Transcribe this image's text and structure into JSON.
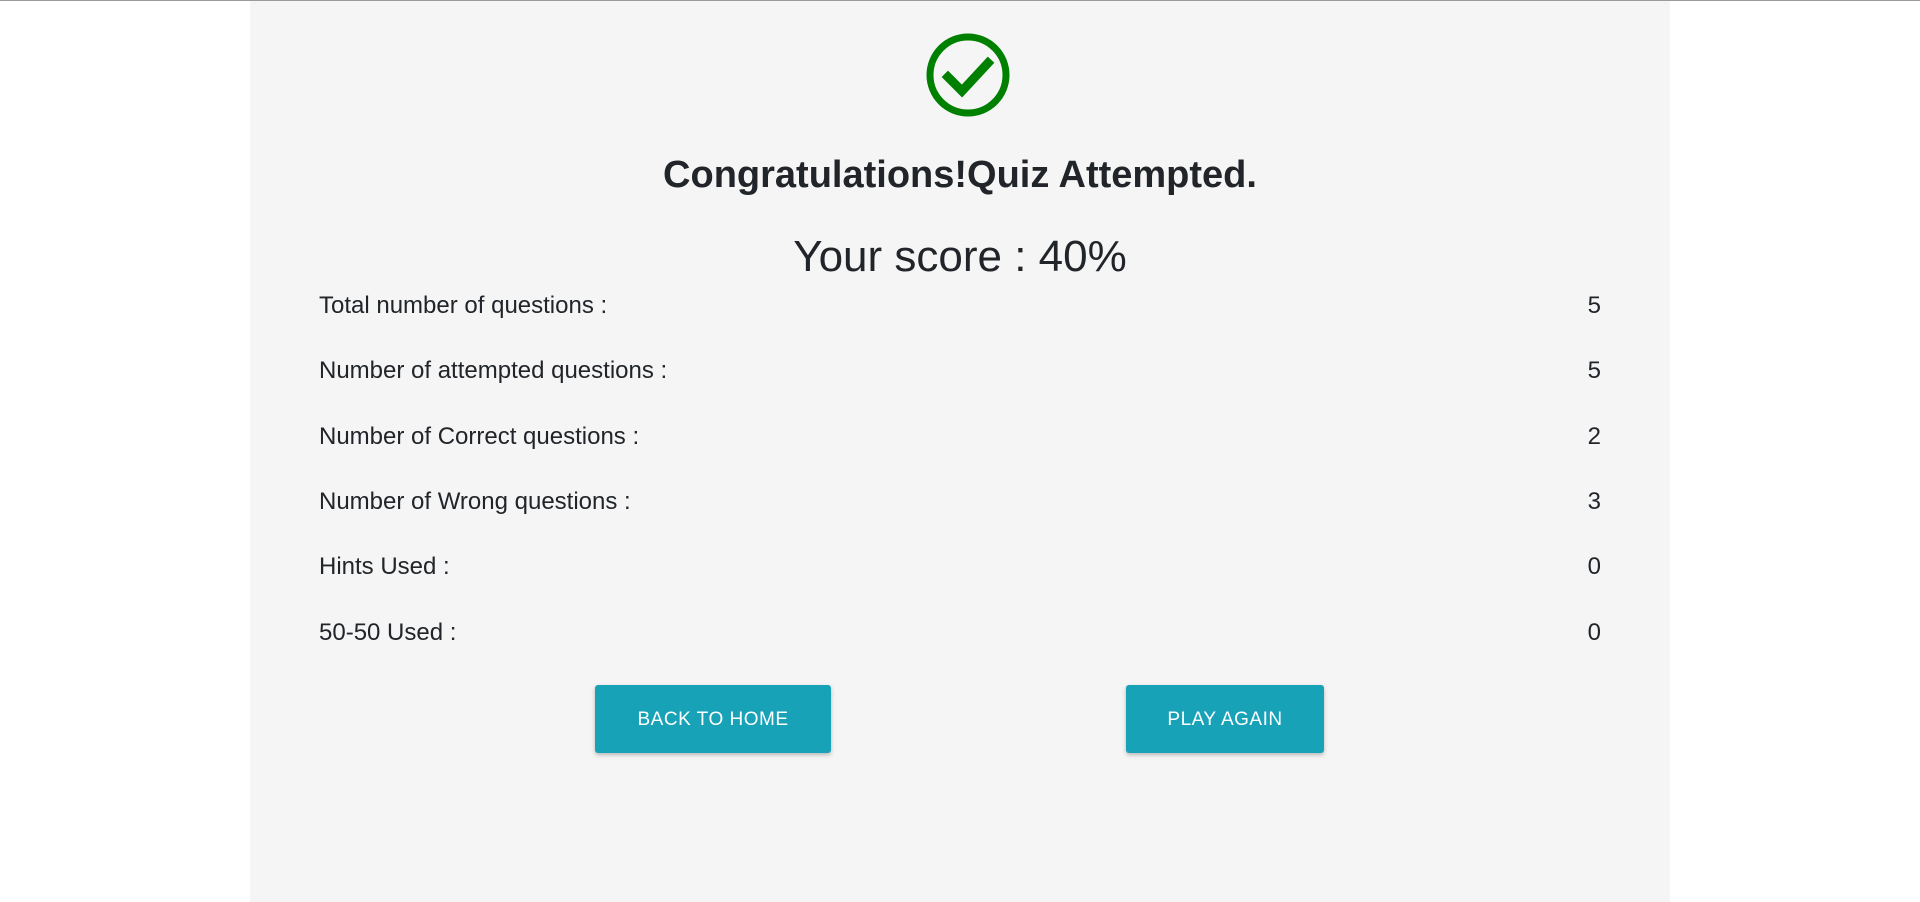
{
  "status": {
    "icon": "check-circle-icon",
    "icon_color": "#008000"
  },
  "title": "Congratulations!Quiz Attempted.",
  "score_text": "Your score : 40%",
  "stats": [
    {
      "label": "Total number of questions :",
      "value": "5"
    },
    {
      "label": "Number of attempted questions :",
      "value": "5"
    },
    {
      "label": "Number of Correct questions :",
      "value": "2"
    },
    {
      "label": "Number of Wrong questions :",
      "value": "3"
    },
    {
      "label": "Hints Used :",
      "value": "0"
    },
    {
      "label": "50-50 Used :",
      "value": "0"
    }
  ],
  "actions": {
    "back_home_label": "BACK TO HOME",
    "play_again_label": "PLAY AGAIN",
    "button_color": "#17a2b8"
  }
}
